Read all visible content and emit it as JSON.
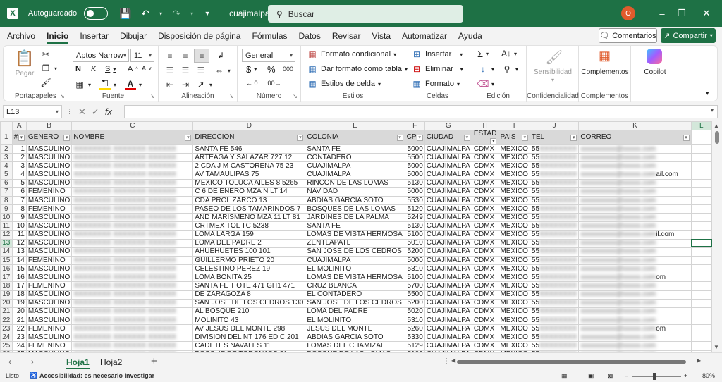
{
  "titlebar": {
    "autosave_label": "Autoguardado",
    "filename": "cuajimalpa",
    "search_placeholder": "Buscar",
    "avatar_initial": "O"
  },
  "menu": {
    "items": [
      "Archivo",
      "Inicio",
      "Insertar",
      "Dibujar",
      "Disposición de página",
      "Fórmulas",
      "Datos",
      "Revisar",
      "Vista",
      "Automatizar",
      "Ayuda"
    ],
    "comments": "Comentarios",
    "share": "Compartir"
  },
  "ribbon": {
    "clipboard": {
      "paste": "Pegar",
      "label": "Portapapeles"
    },
    "font": {
      "name": "Aptos Narrow",
      "size": "11",
      "label": "Fuente"
    },
    "alignment": {
      "label": "Alineación"
    },
    "number": {
      "format": "General",
      "label": "Número",
      "currency": "$",
      "percent": "%",
      "thousands": "000"
    },
    "styles": {
      "conditional": "Formato condicional",
      "table": "Dar formato como tabla",
      "cell_styles": "Estilos de celda",
      "label": "Estilos"
    },
    "cells": {
      "insert": "Insertar",
      "delete": "Eliminar",
      "format": "Formato",
      "label": "Celdas"
    },
    "editing": {
      "label": "Edición"
    },
    "sensitivity": {
      "button": "Sensibilidad",
      "label": "Confidencialidad"
    },
    "addins": {
      "button": "Complementos",
      "label": "Complementos"
    },
    "copilot": {
      "button": "Copilot"
    }
  },
  "formula_bar": {
    "name_box": "L13",
    "fx": "fx",
    "formula": ""
  },
  "grid": {
    "columns": [
      "A",
      "B",
      "C",
      "D",
      "E",
      "F",
      "G",
      "H",
      "I",
      "J",
      "K",
      "L"
    ],
    "headers": [
      "#",
      "GENERO",
      "NOMBRE",
      "DIRECCION",
      "COLONIA",
      "CP",
      "CIUDAD",
      "ESTAD",
      "PAIS",
      "TEL",
      "CORREO",
      ""
    ],
    "selected_cell": "L13",
    "rows": [
      [
        "1",
        "MASCULINO",
        "",
        "SANTA FE 546",
        "SANTA FE",
        "5000",
        "CUAJIMALPA",
        "CDMX",
        "MEXICO",
        "55",
        ""
      ],
      [
        "2",
        "MASCULINO",
        "",
        "ARTEAGA Y SALAZAR 727 12",
        "CONTADERO",
        "5500",
        "CUAJIMALPA",
        "CDMX",
        "MEXICO",
        "55",
        ""
      ],
      [
        "3",
        "MASCULINO",
        "",
        "2 CDA J M CASTORENA 75 23",
        "CUAJIMALPA",
        "5000",
        "CUAJIMALPA",
        "CDMX",
        "MEXICO",
        "55",
        ""
      ],
      [
        "4",
        "MASCULINO",
        "",
        "AV TAMAULIPAS 75",
        "CUAJIMALPA",
        "5000",
        "CUAJIMALPA",
        "CDMX",
        "MEXICO",
        "55",
        "ail.com"
      ],
      [
        "5",
        "MASCULINO",
        "",
        "MEXICO TOLUCA AILES 8 5265",
        "RINCON DE LAS LOMAS",
        "5130",
        "CUAJIMALPA",
        "CDMX",
        "MEXICO",
        "55",
        ""
      ],
      [
        "6",
        "FEMENINO",
        "",
        "C 6 DE ENERO MZA N LT 14",
        "NAVIDAD",
        "5000",
        "CUAJIMALPA",
        "CDMX",
        "MEXICO",
        "55",
        ""
      ],
      [
        "7",
        "MASCULINO",
        "",
        "CDA PROL ZARCO 13",
        "ABDIAS GARCIA SOTO",
        "5530",
        "CUAJIMALPA",
        "CDMX",
        "MEXICO",
        "55",
        ""
      ],
      [
        "8",
        "FEMENINO",
        "",
        "PASEO DE LOS TAMARINDOS 7",
        "BOSQUES DE LAS LOMAS",
        "5120",
        "CUAJIMALPA",
        "CDMX",
        "MEXICO",
        "55",
        ""
      ],
      [
        "9",
        "MASCULINO",
        "",
        "AND MARISMEÑO MZA 11 LT 81",
        "JARDINES DE LA PALMA",
        "5249",
        "CUAJIMALPA",
        "CDMX",
        "MEXICO",
        "55",
        ""
      ],
      [
        "10",
        "MASCULINO",
        "",
        "CRTMEX TOL TC 5238",
        "SANTA FE",
        "5130",
        "CUAJIMALPA",
        "CDMX",
        "MEXICO",
        "55",
        ""
      ],
      [
        "11",
        "MASCULINO",
        "",
        "LOMA LARGA 159",
        "LOMAS DE VISTA HERMOSA",
        "5100",
        "CUAJIMALPA",
        "CDMX",
        "MEXICO",
        "55",
        "il.com"
      ],
      [
        "12",
        "MASCULINO",
        "",
        "LOMA DEL PADRE 2",
        "ZENTLAPATL",
        "5010",
        "CUAJIMALPA",
        "CDMX",
        "MEXICO",
        "55",
        ""
      ],
      [
        "13",
        "MASCULINO",
        "",
        "AHUEHUETES 100 101",
        "SAN JOSE DE LOS CEDROS",
        "5200",
        "CUAJIMALPA",
        "CDMX",
        "MEXICO",
        "55",
        ""
      ],
      [
        "14",
        "FEMENINO",
        "",
        "GUILLERMO PRIETO 20",
        "CUAJIMALPA",
        "5000",
        "CUAJIMALPA",
        "CDMX",
        "MEXICO",
        "55",
        ""
      ],
      [
        "15",
        "MASCULINO",
        "",
        "CELESTINO PEREZ 19",
        "EL MOLINITO",
        "5310",
        "CUAJIMALPA",
        "CDMX",
        "MEXICO",
        "55",
        ""
      ],
      [
        "16",
        "MASCULINO",
        "",
        "LOMA BONITA 25",
        "LOMAS DE VISTA HERMOSA",
        "5100",
        "CUAJIMALPA",
        "CDMX",
        "MEXICO",
        "55",
        "om"
      ],
      [
        "17",
        "FEMENINO",
        "",
        "SANTA FE T OTE 471 GH1 471",
        "CRUZ BLANCA",
        "5700",
        "CUAJIMALPA",
        "CDMX",
        "MEXICO",
        "55",
        ""
      ],
      [
        "18",
        "MASCULINO",
        "",
        "DE ZARAGOZA 8",
        "EL CONTADERO",
        "5500",
        "CUAJIMALPA",
        "CDMX",
        "MEXICO",
        "55",
        ""
      ],
      [
        "19",
        "MASCULINO",
        "",
        "SAN JOSE DE LOS CEDROS 130",
        "SAN JOSE DE LOS CEDROS",
        "5200",
        "CUAJIMALPA",
        "CDMX",
        "MEXICO",
        "55",
        ""
      ],
      [
        "20",
        "MASCULINO",
        "",
        "AL BOSQUE 210",
        "LOMA DEL PADRE",
        "5020",
        "CUAJIMALPA",
        "CDMX",
        "MEXICO",
        "55",
        ""
      ],
      [
        "21",
        "MASCULINO",
        "",
        "MOLINITO 43",
        "EL MOLINITO",
        "5310",
        "CUAJIMALPA",
        "CDMX",
        "MEXICO",
        "55",
        ""
      ],
      [
        "22",
        "FEMENINO",
        "",
        "AV JESUS DEL MONTE 298",
        "JESUS DEL MONTE",
        "5260",
        "CUAJIMALPA",
        "CDMX",
        "MEXICO",
        "55",
        "om"
      ],
      [
        "23",
        "MASCULINO",
        "",
        "DIVISION DEL NT 176 ED C 201",
        "ABDIAS GARCIA SOTO",
        "5330",
        "CUAJIMALPA",
        "CDMX",
        "MEXICO",
        "55",
        ""
      ],
      [
        "24",
        "FEMENINO",
        "",
        "CADETES NAVALES 11",
        "LOMAS DEL CHAMIZAL",
        "5129",
        "CUAJIMALPA",
        "CDMX",
        "MEXICO",
        "55",
        ""
      ],
      [
        "25",
        "MASCULINO",
        "",
        "BOSQUE DE TORONJOS 21",
        "BOSQUE DE LAS LOMAS",
        "5100",
        "CUAJIMALPA",
        "CDMX",
        "MEXICO",
        "55",
        ""
      ]
    ]
  },
  "sheets": {
    "tabs": [
      "Hoja1",
      "Hoja2"
    ],
    "active": "Hoja1"
  },
  "status": {
    "ready": "Listo",
    "accessibility": "Accesibilidad: es necesario investigar",
    "zoom": "80%"
  },
  "colors": {
    "brand": "#1e7145",
    "header_fill": "#d9d9d9",
    "selection": "#1e7145"
  }
}
